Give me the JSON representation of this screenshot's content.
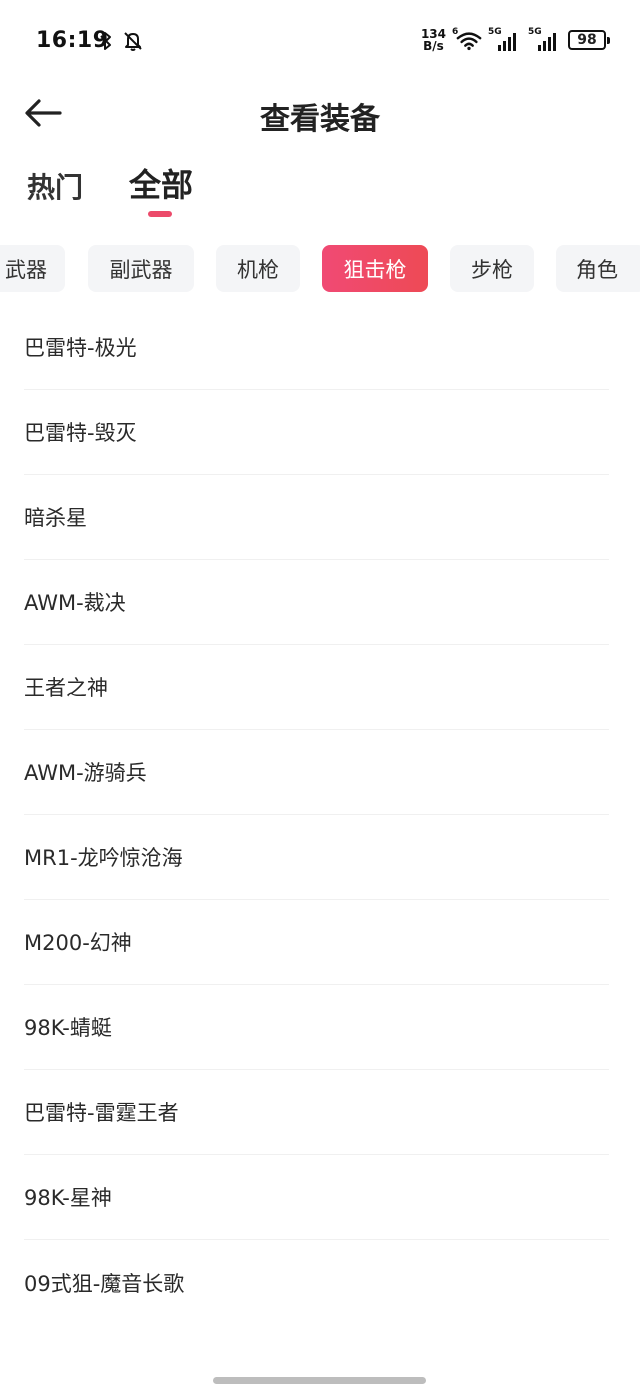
{
  "status_bar": {
    "time": "16:19",
    "net_speed_value": "134",
    "net_speed_unit": "B/s",
    "wifi_label": "6",
    "sim1_label": "5G",
    "sim2_label": "5G",
    "battery": "98"
  },
  "header": {
    "title": "查看装备"
  },
  "tabs": [
    {
      "label": "热门",
      "active": false
    },
    {
      "label": "全部",
      "active": true
    }
  ],
  "chips": [
    {
      "label": "武器",
      "active": false
    },
    {
      "label": "副武器",
      "active": false
    },
    {
      "label": "机枪",
      "active": false
    },
    {
      "label": "狙击枪",
      "active": true
    },
    {
      "label": "步枪",
      "active": false
    },
    {
      "label": "角色",
      "active": false
    }
  ],
  "items": [
    "巴雷特-极光",
    "巴雷特-毁灭",
    "暗杀星",
    "AWM-裁决",
    "王者之神",
    "AWM-游骑兵",
    "MR1-龙吟惊沧海",
    "M200-幻神",
    "98K-蜻蜓",
    "巴雷特-雷霆王者",
    "98K-星神",
    "09式狙-魔音长歌"
  ],
  "colors": {
    "accent": "#ee4a62",
    "chip_bg": "#f4f5f7"
  }
}
